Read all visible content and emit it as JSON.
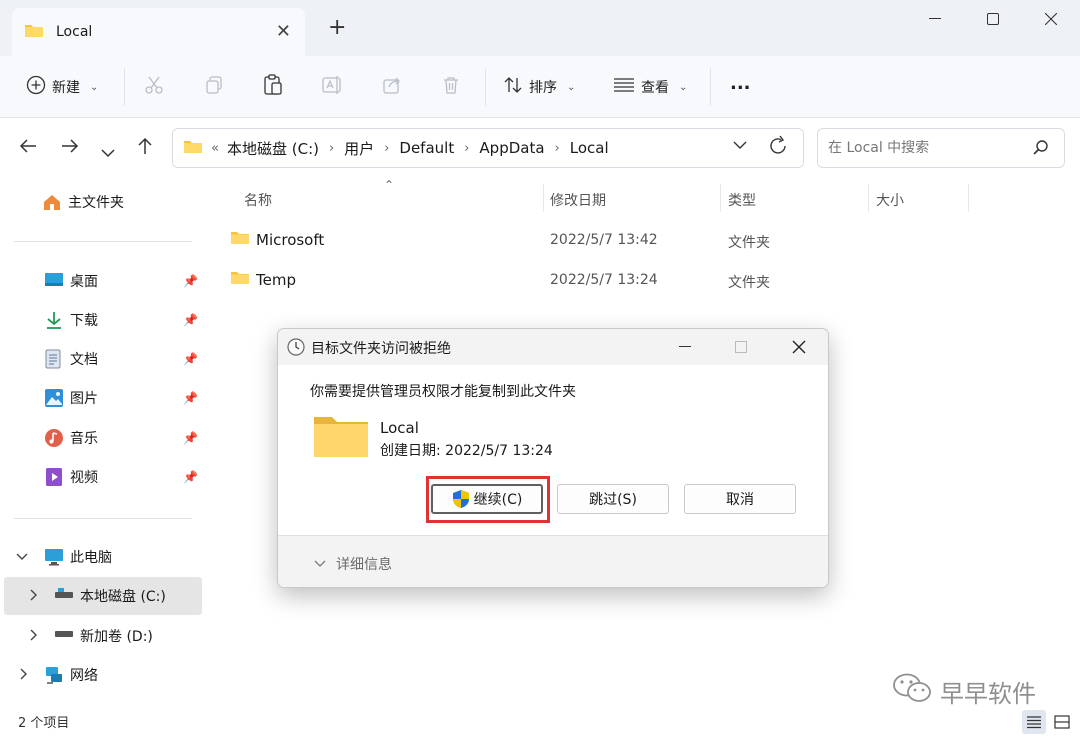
{
  "window": {
    "tab_title": "Local",
    "new_tab_symbol": "+"
  },
  "toolbar": {
    "new_label": "新建",
    "sort_label": "排序",
    "view_label": "查看",
    "more_label": "..."
  },
  "address": {
    "overflow": "«",
    "crumbs": [
      "本地磁盘 (C:)",
      "用户",
      "Default",
      "AppData",
      "Local"
    ],
    "search_placeholder": "在 Local 中搜索"
  },
  "sidebar": {
    "home": "主文件夹",
    "quick": [
      {
        "label": "桌面",
        "icon": "desktop-icon"
      },
      {
        "label": "下载",
        "icon": "download-icon"
      },
      {
        "label": "文档",
        "icon": "document-icon"
      },
      {
        "label": "图片",
        "icon": "picture-icon"
      },
      {
        "label": "音乐",
        "icon": "music-icon"
      },
      {
        "label": "视频",
        "icon": "video-icon"
      }
    ],
    "this_pc": "此电脑",
    "drive_c": "本地磁盘 (C:)",
    "drive_d": "新加卷 (D:)",
    "network": "网络"
  },
  "columns": {
    "name": "名称",
    "modified": "修改日期",
    "type": "类型",
    "size": "大小"
  },
  "files": [
    {
      "name": "Microsoft",
      "modified": "2022/5/7 13:42",
      "type": "文件夹"
    },
    {
      "name": "Temp",
      "modified": "2022/5/7 13:24",
      "type": "文件夹"
    }
  ],
  "status": {
    "count": "2 个项目"
  },
  "dialog": {
    "title": "目标文件夹访问被拒绝",
    "message": "你需要提供管理员权限才能复制到此文件夹",
    "folder_name": "Local",
    "created": "创建日期: 2022/5/7 13:24",
    "continue_label": "继续(C)",
    "skip_label": "跳过(S)",
    "cancel_label": "取消",
    "details_label": "详细信息"
  },
  "watermark": {
    "text": "早早软件"
  },
  "colors": {
    "folder_yellow": "#f5c242",
    "highlight_red": "#e23333",
    "accent_blue": "#1a73c8"
  }
}
